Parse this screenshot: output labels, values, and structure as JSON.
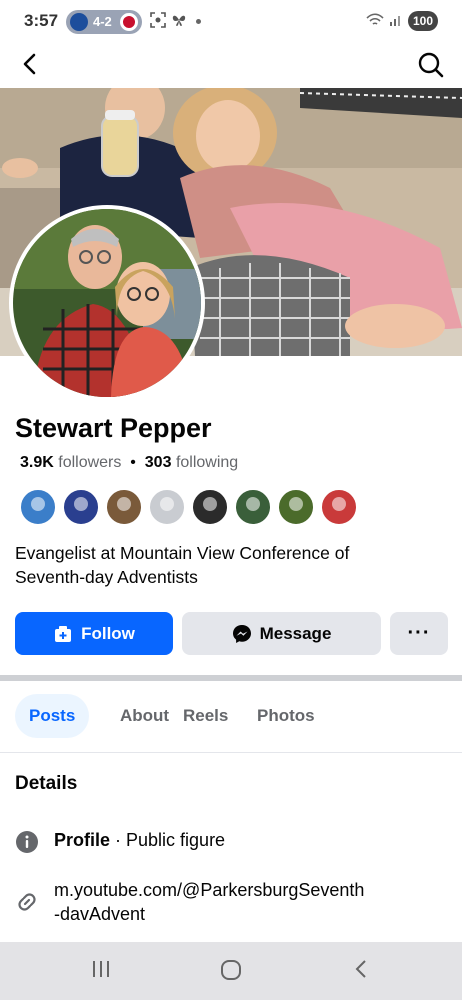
{
  "status_bar": {
    "time": "3:57",
    "score": "4-2",
    "battery": "100",
    "icons": [
      "nfl-team-icon",
      "cardinals-team-icon",
      "screenshot-icon",
      "butterfly-icon",
      "dot-icon",
      "wifi-icon",
      "signal-icon"
    ]
  },
  "nav": {
    "back_icon": "back-arrow-icon",
    "search_icon": "search-icon"
  },
  "profile": {
    "name": "Stewart Pepper",
    "followers_count": "3.9K",
    "followers_label": "followers",
    "separator": "•",
    "following_count": "303",
    "following_label": "following",
    "bio_line1": "Evangelist at Mountain View Conference of",
    "bio_line2": "Seventh-day Adventists"
  },
  "mutual_avatars": [
    "#3b7ec9",
    "#2a3f8f",
    "#7a5a3a",
    "#c9ccd1",
    "#2b2b2b",
    "#3a5f3a",
    "#4b6b2b",
    "#c93a3a"
  ],
  "actions": {
    "follow_label": "Follow",
    "message_label": "Message",
    "more_label": "···"
  },
  "tabs": [
    {
      "label": "Posts",
      "active": true
    },
    {
      "label": "About",
      "active": false
    },
    {
      "label": "Reels",
      "active": false
    },
    {
      "label": "Photos",
      "active": false
    }
  ],
  "details": {
    "title": "Details",
    "profile_label": "Profile",
    "profile_separator": " · ",
    "profile_value": "Public figure",
    "link_line1": "m.youtube.com/@ParkersburgSeventh",
    "link_line2": "-davAdvent"
  },
  "colors": {
    "accent": "#0866ff",
    "button_gray": "#e4e6eb",
    "secondary_text": "#65676b"
  }
}
